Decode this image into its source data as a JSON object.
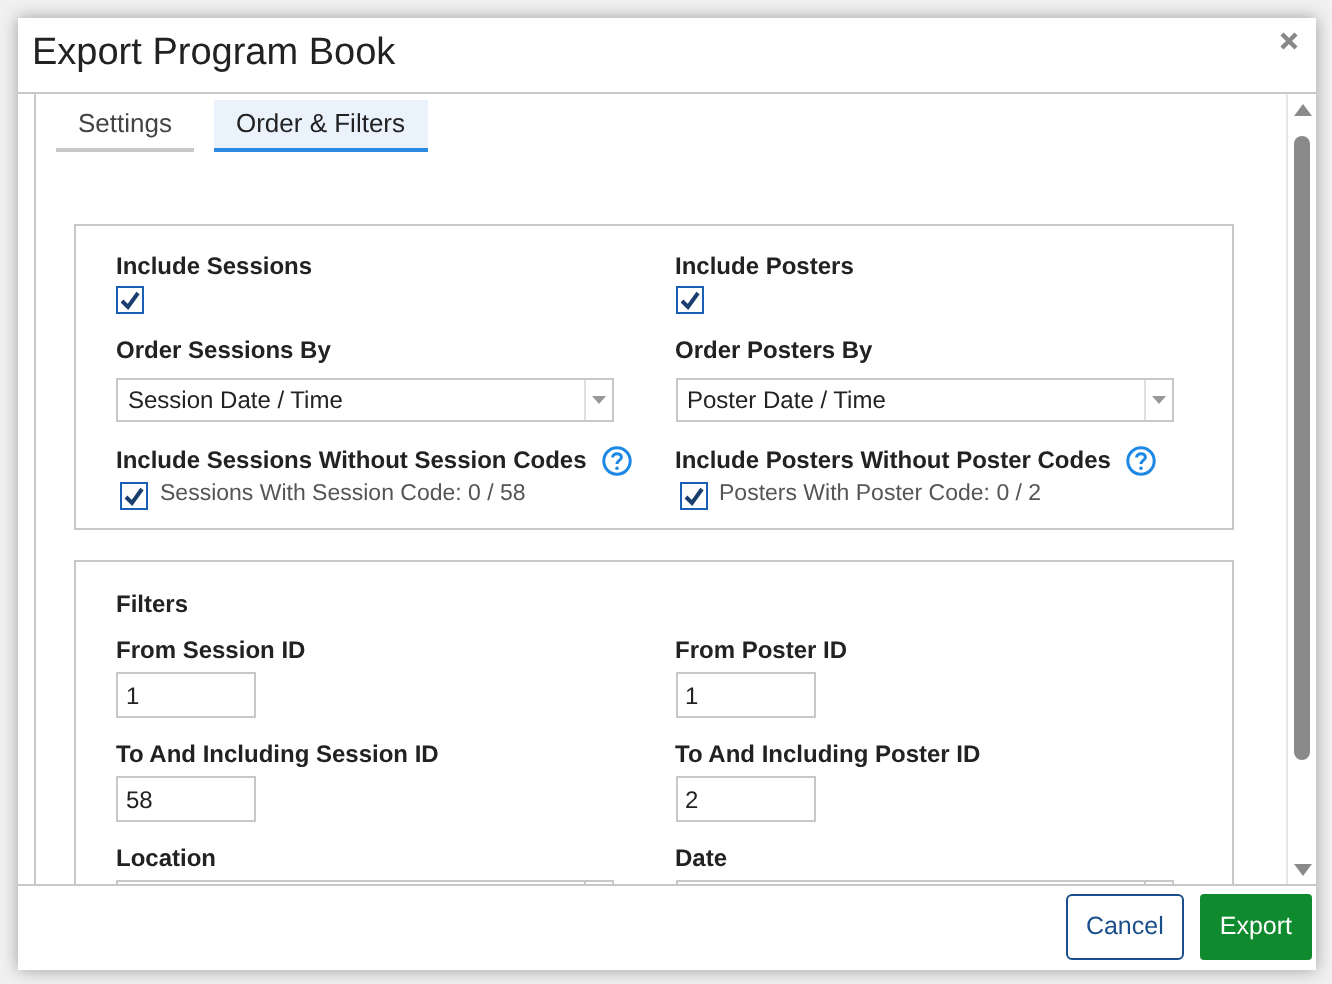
{
  "window": {
    "title": "Export Program Book"
  },
  "tabs": [
    {
      "label": "Settings",
      "selected": false
    },
    {
      "label": "Order & Filters",
      "selected": true
    }
  ],
  "order_section": {
    "columns": [
      {
        "include": {
          "label": "Include Sessions",
          "checked": true
        },
        "order": {
          "label": "Order Sessions By",
          "value": "Session Date / Time"
        },
        "without_codes": {
          "label": "Include Sessions Without Session Codes",
          "checked": true,
          "note": "Sessions With Session Code: 0 / 58"
        }
      },
      {
        "include": {
          "label": "Include Posters",
          "checked": true
        },
        "order": {
          "label": "Order Posters By",
          "value": "Poster Date / Time"
        },
        "without_codes": {
          "label": "Include Posters Without Poster Codes",
          "checked": true,
          "note": "Posters With Poster Code: 0 / 2"
        }
      }
    ]
  },
  "filters": {
    "title": "Filters",
    "columns": [
      {
        "fields": [
          {
            "kind": "text",
            "label": "From Session ID",
            "value": "1"
          },
          {
            "kind": "text",
            "label": "To And Including Session ID",
            "value": "58"
          },
          {
            "kind": "select",
            "label": "Location"
          }
        ]
      },
      {
        "fields": [
          {
            "kind": "text",
            "label": "From Poster ID",
            "value": "1"
          },
          {
            "kind": "text",
            "label": "To And Including Poster ID",
            "value": "2"
          },
          {
            "kind": "select",
            "label": "Date"
          }
        ]
      }
    ]
  },
  "buttons": [
    {
      "label": "Cancel",
      "kind": "secondary"
    },
    {
      "label": "Export",
      "kind": "primary"
    }
  ]
}
